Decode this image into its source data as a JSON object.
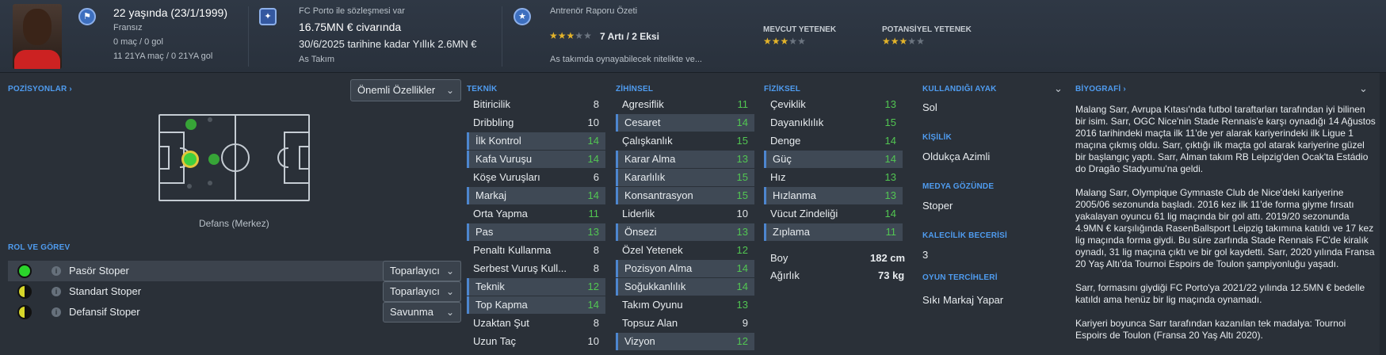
{
  "header": {
    "age": "22 yaşında (23/1/1999)",
    "nationality": "Fransız",
    "caps": "0 maç / 0 gol",
    "u21_caps": "11 21YA maç / 0 21YA gol",
    "contract_status": "FC Porto ile sözleşmesi var",
    "value": "16.75MN € civarında",
    "wage": "30/6/2025 tarihine kadar Yıllık 2.6MN €",
    "squad_status": "As Takım",
    "report_title": "Antrenör Raporu Özeti",
    "report_summary": "7 Artı / 2 Eksi",
    "report_stars": 3,
    "report_note": "As takımda oynayabilecek nitelikte ve...",
    "current_ability_label": "MEVCUT YETENEK",
    "current_ability_stars": 3,
    "potential_ability_label": "POTANSİYEL YETENEK",
    "potential_ability_stars": 3
  },
  "positions": {
    "title": "POZİSYONLAR",
    "filter": "Önemli Özellikler",
    "position_label": "Defans (Merkez)"
  },
  "roles": {
    "title": "ROL VE GÖREV",
    "items": [
      {
        "name": "Pasör Stoper",
        "duty": "Toparlayıcı",
        "rating_color": "#2bd42b"
      },
      {
        "name": "Standart Stoper",
        "duty": "Toparlayıcı",
        "rating_color": "#d6d62a"
      },
      {
        "name": "Defansif Stoper",
        "duty": "Savunma",
        "rating_color": "#d6d62a"
      }
    ]
  },
  "technical": {
    "title": "TEKNİK",
    "items": [
      {
        "name": "Bitiricilik",
        "value": "8"
      },
      {
        "name": "Dribbling",
        "value": "10"
      },
      {
        "name": "İlk Kontrol",
        "value": "14"
      },
      {
        "name": "Kafa Vuruşu",
        "value": "14"
      },
      {
        "name": "Köşe Vuruşları",
        "value": "6"
      },
      {
        "name": "Markaj",
        "value": "14"
      },
      {
        "name": "Orta Yapma",
        "value": "11"
      },
      {
        "name": "Pas",
        "value": "13"
      },
      {
        "name": "Penaltı Kullanma",
        "value": "8"
      },
      {
        "name": "Serbest Vuruş Kull...",
        "value": "8"
      },
      {
        "name": "Teknik",
        "value": "12"
      },
      {
        "name": "Top Kapma",
        "value": "14"
      },
      {
        "name": "Uzaktan Şut",
        "value": "8"
      },
      {
        "name": "Uzun Taç",
        "value": "10"
      }
    ]
  },
  "mental": {
    "title": "ZİHİNSEL",
    "items": [
      {
        "name": "Agresiflik",
        "value": "11"
      },
      {
        "name": "Cesaret",
        "value": "14"
      },
      {
        "name": "Çalışkanlık",
        "value": "15"
      },
      {
        "name": "Karar Alma",
        "value": "13"
      },
      {
        "name": "Kararlılık",
        "value": "15"
      },
      {
        "name": "Konsantrasyon",
        "value": "15"
      },
      {
        "name": "Liderlik",
        "value": "10"
      },
      {
        "name": "Önsezi",
        "value": "13"
      },
      {
        "name": "Özel Yetenek",
        "value": "12"
      },
      {
        "name": "Pozisyon Alma",
        "value": "14"
      },
      {
        "name": "Soğukkanlılık",
        "value": "14"
      },
      {
        "name": "Takım Oyunu",
        "value": "13"
      },
      {
        "name": "Topsuz Alan",
        "value": "9"
      },
      {
        "name": "Vizyon",
        "value": "12"
      }
    ]
  },
  "physical": {
    "title": "FİZİKSEL",
    "items": [
      {
        "name": "Çeviklik",
        "value": "13"
      },
      {
        "name": "Dayanıklılık",
        "value": "15"
      },
      {
        "name": "Denge",
        "value": "14"
      },
      {
        "name": "Güç",
        "value": "14"
      },
      {
        "name": "Hız",
        "value": "13"
      },
      {
        "name": "Hızlanma",
        "value": "13"
      },
      {
        "name": "Vücut Zindeliği",
        "value": "14"
      },
      {
        "name": "Zıplama",
        "value": "11"
      }
    ],
    "height_label": "Boy",
    "height": "182 cm",
    "weight_label": "Ağırlık",
    "weight": "73 kg"
  },
  "info": {
    "foot_title": "KULLANDIĞI AYAK",
    "foot": "Sol",
    "personality_title": "KİŞİLİK",
    "personality": "Oldukça Azimli",
    "media_title": "MEDYA GÖZÜNDE",
    "media": "Stoper",
    "gk_title": "KALECİLİK BECERİSİ",
    "gk": "3",
    "pref_title": "OYUN TERCİHLERİ",
    "pref": "Sıkı Markaj Yapar"
  },
  "bio": {
    "title": "BİYOGRAFİ",
    "p1": "Malang Sarr, Avrupa Kıtası'nda futbol taraftarları tarafından iyi bilinen bir isim. Sarr, OGC Nice'nin Stade Rennais'e karşı oynadığı 14 Ağustos 2016 tarihindeki maçta ilk 11'de yer alarak kariyerindeki ilk Ligue 1 maçına çıkmış oldu. Sarr, çıktığı ilk maçta gol atarak kariyerine güzel bir başlangıç yaptı. Sarr, Alman takım RB Leipzig'den Ocak'ta Estádio do Dragão Stadyumu'na geldi.",
    "p2": "Malang Sarr, Olympique Gymnaste Club de Nice'deki kariyerine 2005/06 sezonunda başladı. 2016 kez ilk 11'de forma giyme fırsatı yakalayan oyuncu 61 lig maçında bir gol attı. 2019/20 sezonunda 4.9MN € karşılığında RasenBallsport Leipzig takımına katıldı ve 17 kez lig maçında forma giydi. Bu süre zarfında Stade Rennais FC'de kiralık oynadı, 31 lig maçına çıktı ve bir gol kaydetti. Sarr, 2020 yılında Fransa 20 Yaş Altı'da Tournoi Espoirs de Toulon şampiyonluğu yaşadı.",
    "p3": "Sarr, formasını giydiği FC Porto'ya 2021/22 yılında 12.5MN € bedelle katıldı ama henüz bir lig maçında oynamadı.",
    "p4": "Kariyeri boyunca Sarr tarafından kazanılan tek madalya: Tournoi Espoirs de Toulon (Fransa 20 Yaş Altı 2020)."
  },
  "colors": {
    "accent": "#4f9cf0",
    "good": "#52c652",
    "star": "#e3b32a"
  }
}
